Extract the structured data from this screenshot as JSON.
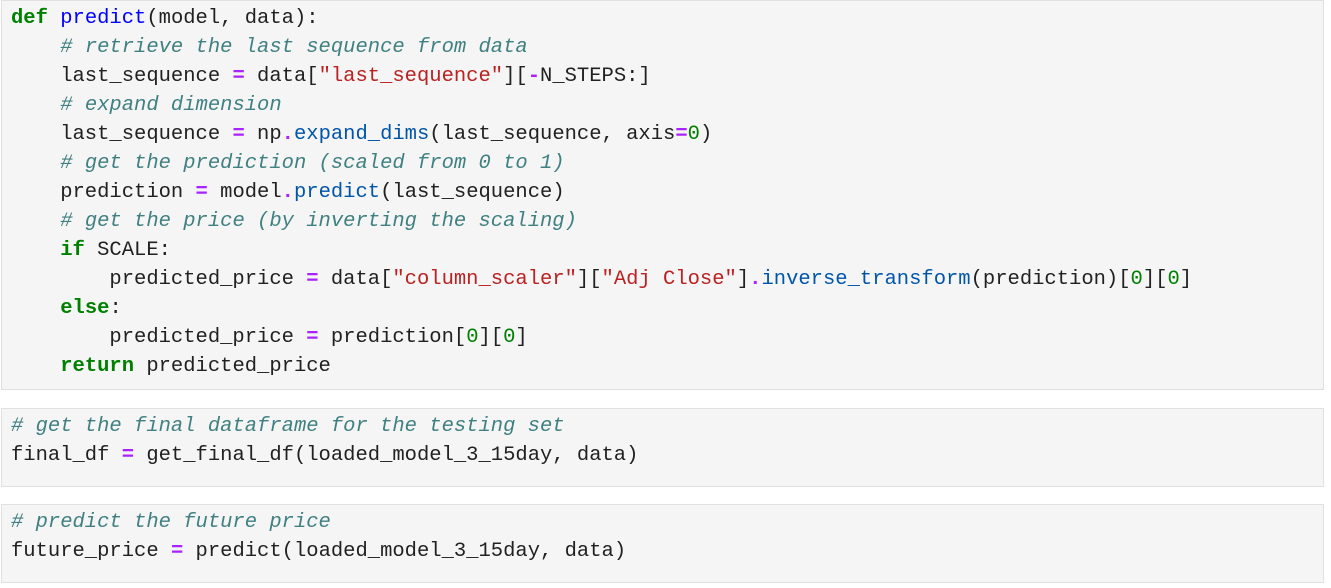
{
  "theme": {
    "background": "#f5f5f5",
    "border": "#e0e0e0",
    "keyword": "#008000",
    "function_name": "#0000ff",
    "comment": "#408080",
    "string": "#ba2121",
    "operator": "#aa22ff",
    "number": "#008000",
    "attribute": "#0055aa"
  },
  "cells": [
    {
      "lines": [
        [
          [
            "kw",
            "def"
          ],
          [
            "tx",
            " "
          ],
          [
            "fn",
            "predict"
          ],
          [
            "tx",
            "(model, data):"
          ]
        ],
        [
          [
            "tx",
            "    "
          ],
          [
            "cm",
            "# retrieve the last sequence from data"
          ]
        ],
        [
          [
            "tx",
            "    last_sequence "
          ],
          [
            "op",
            "="
          ],
          [
            "tx",
            " data["
          ],
          [
            "st",
            "\"last_sequence\""
          ],
          [
            "tx",
            "]["
          ],
          [
            "op",
            "-"
          ],
          [
            "tx",
            "N_STEPS:]"
          ]
        ],
        [
          [
            "tx",
            "    "
          ],
          [
            "cm",
            "# expand dimension"
          ]
        ],
        [
          [
            "tx",
            "    last_sequence "
          ],
          [
            "op",
            "="
          ],
          [
            "tx",
            " np"
          ],
          [
            "op",
            "."
          ],
          [
            "at",
            "expand_dims"
          ],
          [
            "tx",
            "(last_sequence, axis"
          ],
          [
            "op",
            "="
          ],
          [
            "nu",
            "0"
          ],
          [
            "tx",
            ")"
          ]
        ],
        [
          [
            "tx",
            "    "
          ],
          [
            "cm",
            "# get the prediction (scaled from 0 to 1)"
          ]
        ],
        [
          [
            "tx",
            "    prediction "
          ],
          [
            "op",
            "="
          ],
          [
            "tx",
            " model"
          ],
          [
            "op",
            "."
          ],
          [
            "at",
            "predict"
          ],
          [
            "tx",
            "(last_sequence)"
          ]
        ],
        [
          [
            "tx",
            "    "
          ],
          [
            "cm",
            "# get the price (by inverting the scaling)"
          ]
        ],
        [
          [
            "tx",
            "    "
          ],
          [
            "kw",
            "if"
          ],
          [
            "tx",
            " SCALE:"
          ]
        ],
        [
          [
            "tx",
            "        predicted_price "
          ],
          [
            "op",
            "="
          ],
          [
            "tx",
            " data["
          ],
          [
            "st",
            "\"column_scaler\""
          ],
          [
            "tx",
            "]["
          ],
          [
            "st",
            "\"Adj Close\""
          ],
          [
            "tx",
            "]"
          ],
          [
            "op",
            "."
          ],
          [
            "at",
            "inverse_transform"
          ],
          [
            "tx",
            "(prediction)["
          ],
          [
            "nu",
            "0"
          ],
          [
            "tx",
            "]["
          ],
          [
            "nu",
            "0"
          ],
          [
            "tx",
            "]"
          ]
        ],
        [
          [
            "tx",
            "    "
          ],
          [
            "kw",
            "else"
          ],
          [
            "tx",
            ":"
          ]
        ],
        [
          [
            "tx",
            "        predicted_price "
          ],
          [
            "op",
            "="
          ],
          [
            "tx",
            " prediction["
          ],
          [
            "nu",
            "0"
          ],
          [
            "tx",
            "]["
          ],
          [
            "nu",
            "0"
          ],
          [
            "tx",
            "]"
          ]
        ],
        [
          [
            "tx",
            "    "
          ],
          [
            "kw",
            "return"
          ],
          [
            "tx",
            " predicted_price"
          ]
        ]
      ]
    },
    {
      "lines": [
        [
          [
            "cm",
            "# get the final dataframe for the testing set"
          ]
        ],
        [
          [
            "tx",
            "final_df "
          ],
          [
            "op",
            "="
          ],
          [
            "tx",
            " get_final_df(loaded_model_3_15day, data)"
          ]
        ]
      ]
    },
    {
      "lines": [
        [
          [
            "cm",
            "# predict the future price"
          ]
        ],
        [
          [
            "tx",
            "future_price "
          ],
          [
            "op",
            "="
          ],
          [
            "tx",
            " predict(loaded_model_3_15day, data)"
          ]
        ]
      ]
    }
  ]
}
